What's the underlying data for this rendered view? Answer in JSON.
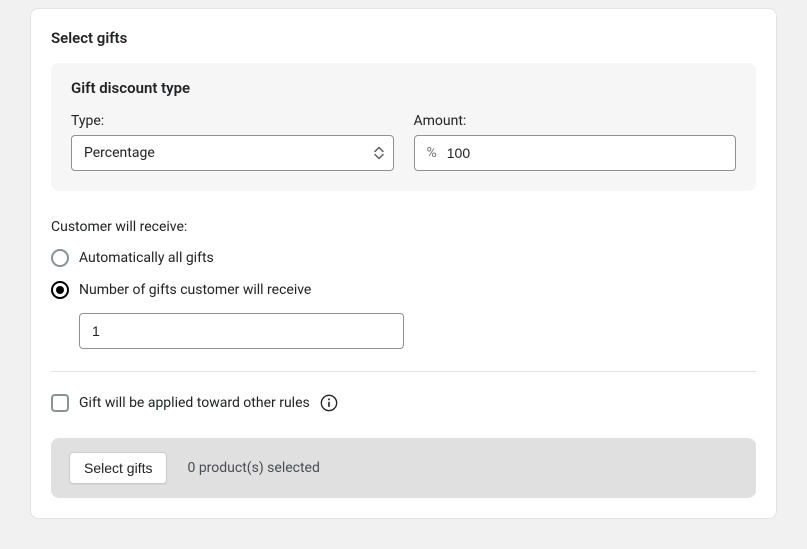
{
  "card_title": "Select gifts",
  "gift_discount_panel": {
    "title": "Gift discount type",
    "type": {
      "label": "Type:",
      "value": "Percentage"
    },
    "amount": {
      "label": "Amount:",
      "prefix": "%",
      "value": "100"
    }
  },
  "customer_receive": {
    "label": "Customer will receive:",
    "options": {
      "all": "Automatically all gifts",
      "number": "Number of gifts customer will receive"
    },
    "number_value": "1"
  },
  "apply_toward_other_rules": {
    "label": "Gift will be applied toward other rules"
  },
  "footer": {
    "button": "Select gifts",
    "selected_text": "0 product(s) selected"
  }
}
